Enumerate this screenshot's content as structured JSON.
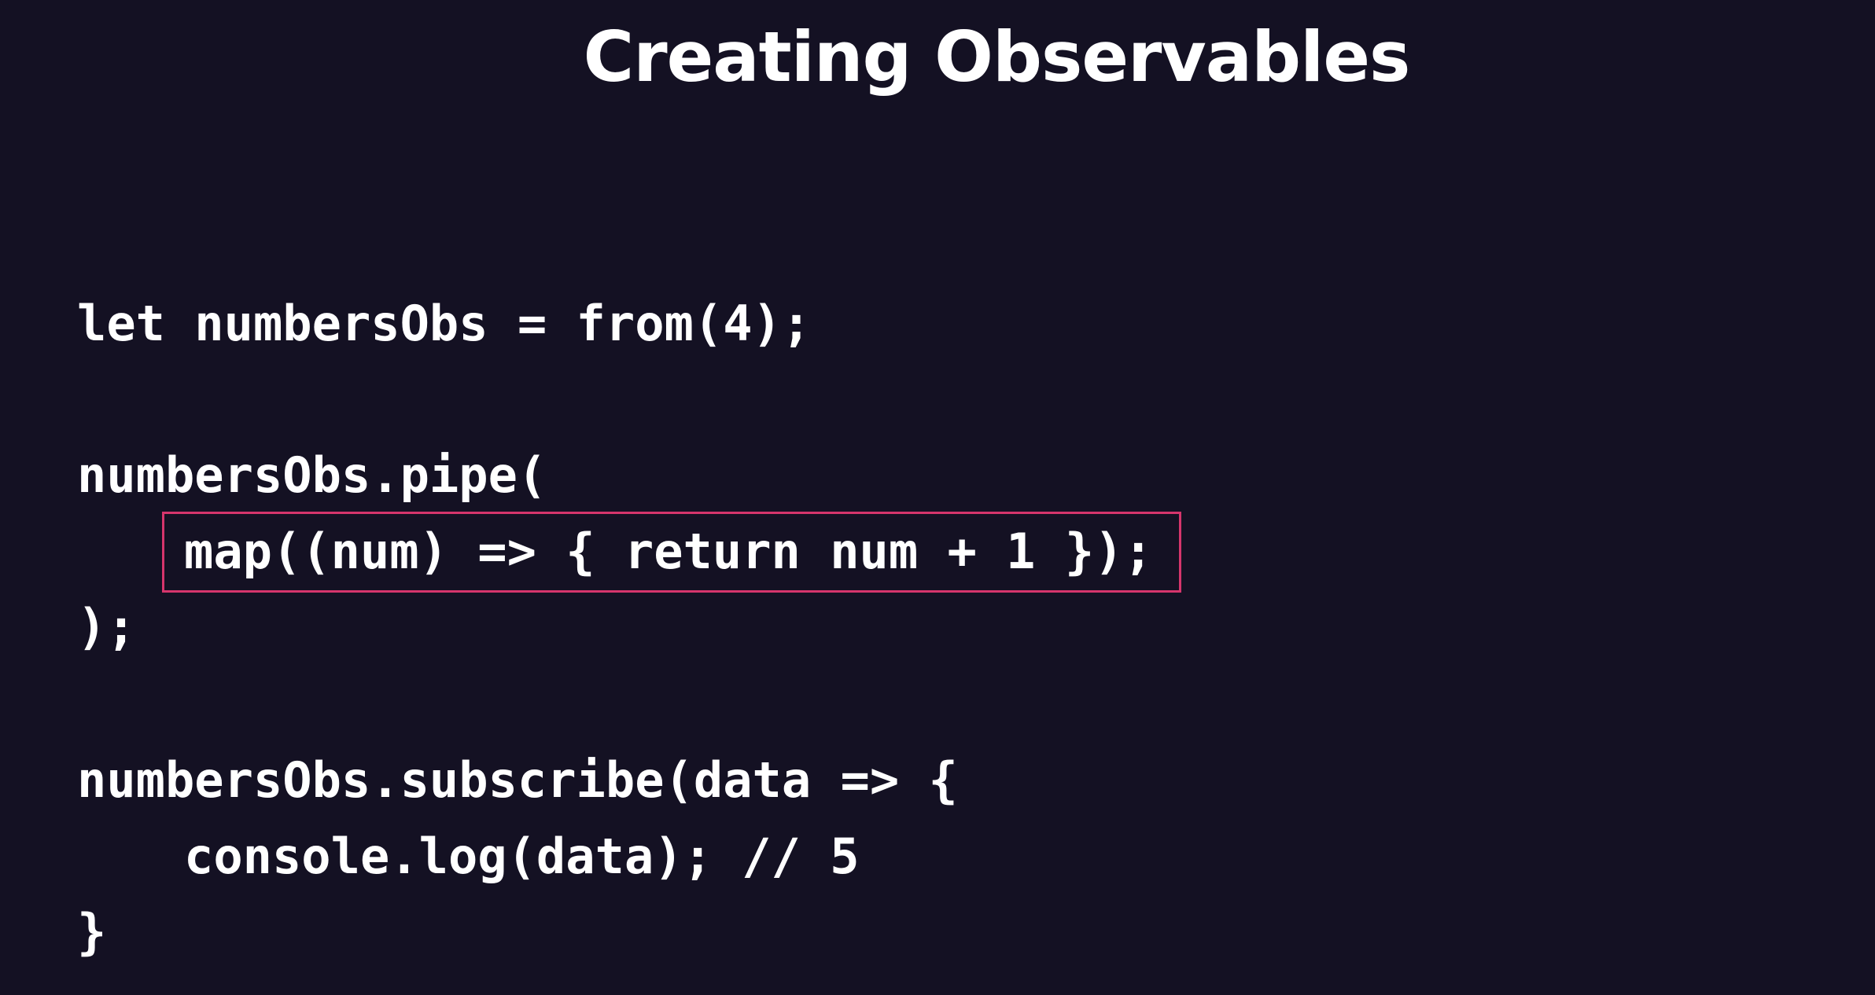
{
  "slide": {
    "title": "Creating Observables"
  },
  "code": {
    "lines": [
      "let numbersObs = from(4);",
      "numbersObs.pipe(",
      "map((num) => { return num + 1 });",
      ");",
      "numbersObs.subscribe(data => {",
      "console.log(data); // 5",
      "}"
    ]
  },
  "colors": {
    "background": "#141123",
    "text": "#ffffff",
    "highlight_border": "#d6356c"
  }
}
